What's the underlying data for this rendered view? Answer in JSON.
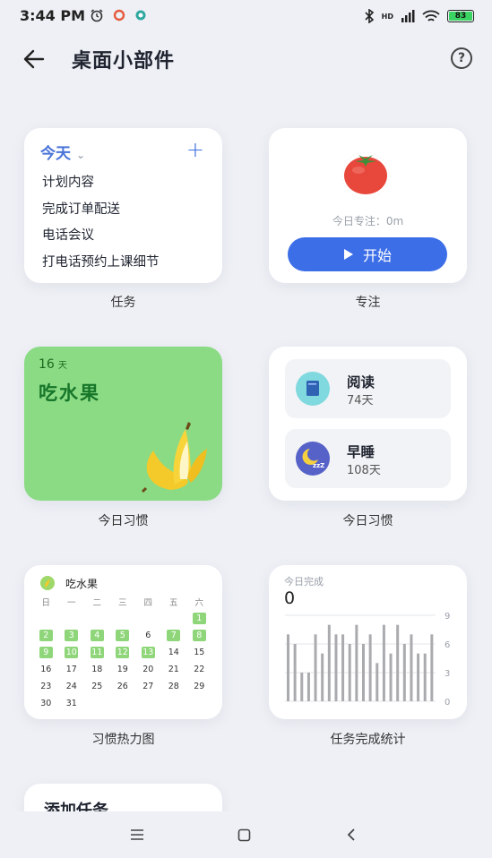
{
  "status": {
    "time": "3:44 PM",
    "signal_label": "HD",
    "battery_level": "83"
  },
  "header": {
    "title": "桌面小部件",
    "help_symbol": "?"
  },
  "widgets": {
    "task": {
      "filter_label": "今天",
      "items": [
        "计划内容",
        "完成订单配送",
        "电话会议",
        "打电话预约上课细节"
      ],
      "caption": "任务"
    },
    "focus": {
      "today_label": "今日专注：0m",
      "start_button": "开始",
      "caption": "专注"
    },
    "habit_single": {
      "days": "16",
      "days_unit": "天",
      "name": "吃水果",
      "caption": "今日习惯"
    },
    "habit_list": {
      "items": [
        {
          "name": "阅读",
          "days": "74天"
        },
        {
          "name": "早睡",
          "days": "108天"
        }
      ],
      "caption": "今日习惯"
    },
    "heatmap": {
      "habit_name": "吃水果",
      "weekdays": [
        "日",
        "一",
        "二",
        "三",
        "四",
        "五",
        "六"
      ],
      "checked_days": [
        1,
        2,
        3,
        4,
        5,
        7,
        8,
        9,
        10,
        11,
        12,
        13
      ],
      "caption": "习惯热力图"
    },
    "stats": {
      "label": "今日完成",
      "count": "0",
      "y_ticks": [
        "9",
        "6",
        "3",
        "0"
      ],
      "caption": "任务完成统计"
    },
    "add_task": {
      "title": "添加任务"
    }
  },
  "chart_data": {
    "type": "bar",
    "ylim": [
      0,
      9
    ],
    "yticks": [
      0,
      3,
      6,
      9
    ],
    "values": [
      7,
      6,
      3,
      3,
      7,
      5,
      8,
      7,
      7,
      6,
      8,
      6,
      7,
      4,
      8,
      5,
      8,
      6,
      7,
      5,
      5,
      7
    ],
    "colors": {
      "bar": "#a9abae",
      "grid": "#e3e5ea"
    }
  },
  "colors": {
    "accent_blue": "#3c6ee8",
    "habit_green": "#8bdb84",
    "heatmap_green": "#8fd67a"
  }
}
